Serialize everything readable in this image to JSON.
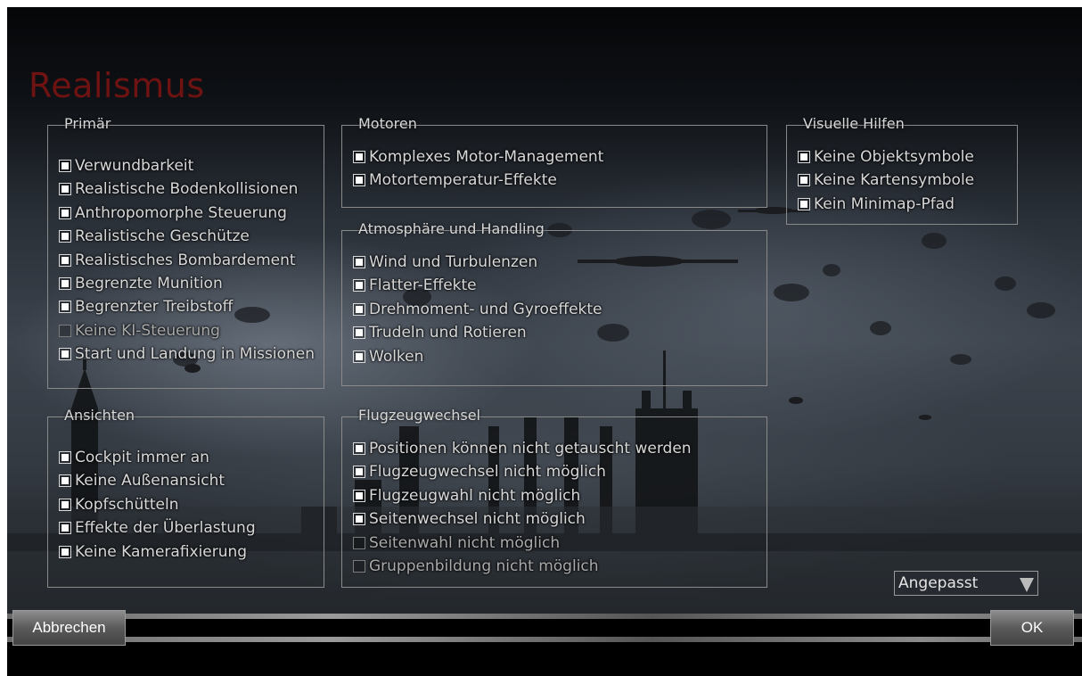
{
  "title": "Realismus",
  "groups": {
    "primaer": {
      "title": "Primär",
      "items": [
        {
          "label": "Verwundbarkeit",
          "checked": true
        },
        {
          "label": "Realistische Bodenkollisionen",
          "checked": true
        },
        {
          "label": "Anthropomorphe Steuerung",
          "checked": true
        },
        {
          "label": "Realistische Geschütze",
          "checked": true
        },
        {
          "label": "Realistisches Bombardement",
          "checked": true
        },
        {
          "label": "Begrenzte Munition",
          "checked": true
        },
        {
          "label": "Begrenzter Treibstoff",
          "checked": true
        },
        {
          "label": "Keine KI-Steuerung",
          "checked": false
        },
        {
          "label": "Start und Landung in Missionen",
          "checked": true
        }
      ]
    },
    "ansichten": {
      "title": "Ansichten",
      "items": [
        {
          "label": "Cockpit immer an",
          "checked": true
        },
        {
          "label": "Keine Außenansicht",
          "checked": true
        },
        {
          "label": "Kopfschütteln",
          "checked": true
        },
        {
          "label": "Effekte der Überlastung",
          "checked": true
        },
        {
          "label": "Keine Kamerafixierung",
          "checked": true
        }
      ]
    },
    "motoren": {
      "title": "Motoren",
      "items": [
        {
          "label": "Komplexes Motor-Management",
          "checked": true
        },
        {
          "label": "Motortemperatur-Effekte",
          "checked": true
        }
      ]
    },
    "atmosphaere": {
      "title": "Atmosphäre und Handling",
      "items": [
        {
          "label": "Wind und Turbulenzen",
          "checked": true
        },
        {
          "label": "Flatter-Effekte",
          "checked": true
        },
        {
          "label": "Drehmoment- und Gyroeffekte",
          "checked": true
        },
        {
          "label": "Trudeln und Rotieren",
          "checked": true
        },
        {
          "label": "Wolken",
          "checked": true
        }
      ]
    },
    "flugzeugwechsel": {
      "title": "Flugzeugwechsel",
      "items": [
        {
          "label": "Positionen können nicht getauscht werden",
          "checked": true
        },
        {
          "label": "Flugzeugwechsel nicht möglich",
          "checked": true
        },
        {
          "label": "Flugzeugwahl nicht möglich",
          "checked": true
        },
        {
          "label": "Seitenwechsel nicht möglich",
          "checked": true
        },
        {
          "label": "Seitenwahl nicht möglich",
          "checked": false
        },
        {
          "label": "Gruppenbildung nicht möglich",
          "checked": false
        }
      ]
    },
    "visuelle": {
      "title": "Visuelle Hilfen",
      "items": [
        {
          "label": "Keine Objektsymbole",
          "checked": true
        },
        {
          "label": "Keine Kartensymbole",
          "checked": true
        },
        {
          "label": "Kein Minimap-Pfad",
          "checked": true
        }
      ]
    }
  },
  "preset_select": {
    "value": "Angepasst"
  },
  "buttons": {
    "cancel": "Abbrechen",
    "ok": "OK"
  },
  "colors": {
    "title": "#6e1212",
    "text": "#d8d8d8",
    "border": "#8a8a8a"
  }
}
